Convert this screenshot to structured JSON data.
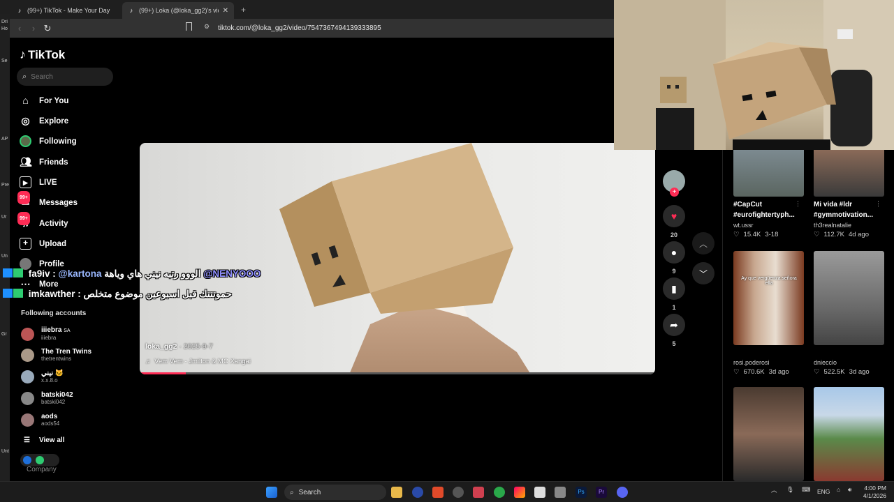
{
  "browser": {
    "tabs": [
      {
        "title": "(99+) TikTok - Make Your Day",
        "active": false
      },
      {
        "title": "(99+) Loka (@loka_gg2)'s videos",
        "active": true
      }
    ],
    "url": "tiktok.com/@loka_gg2/video/7547367494139333895"
  },
  "leftstrip": [
    "Dri",
    "Ho",
    "Se",
    "AP",
    "Pre",
    "Ur",
    "Un",
    "Gr",
    "Unt"
  ],
  "tiktok": {
    "logo": "TikTok",
    "search_placeholder": "Search",
    "nav": [
      {
        "label": "For You",
        "icon": "home-icon"
      },
      {
        "label": "Explore",
        "icon": "compass-icon"
      },
      {
        "label": "Following",
        "icon": "following-avatar-icon"
      },
      {
        "label": "Friends",
        "icon": "friends-icon"
      },
      {
        "label": "LIVE",
        "icon": "live-icon"
      },
      {
        "label": "Messages",
        "icon": "message-icon",
        "badge": "99+"
      },
      {
        "label": "Activity",
        "icon": "bell-icon",
        "badge": "99+"
      },
      {
        "label": "Upload",
        "icon": "upload-icon"
      },
      {
        "label": "Profile",
        "icon": "profile-icon"
      },
      {
        "label": "More",
        "icon": "more-icon"
      }
    ],
    "following_title": "Following accounts",
    "following": [
      {
        "name": "iiiebra",
        "extra": "SA",
        "handle": "iiiebra"
      },
      {
        "name": "The Tren Twins",
        "handle": "thetrentwins"
      },
      {
        "name": "نيني 🐱",
        "handle": "x.x.8.o"
      },
      {
        "name": "batski042",
        "handle": "batski042"
      },
      {
        "name": "aods",
        "handle": "aods54"
      }
    ],
    "view_all": "View all",
    "company": "Company"
  },
  "video": {
    "author": "loka_gg2",
    "date": "2025-9-7",
    "music": "Vem Vem - Jmilton & MC Xangai",
    "progress": 0.09,
    "likes": "20",
    "comments": "9",
    "saves": "1",
    "shares": "5"
  },
  "chat": [
    {
      "user": "fa9iv",
      "mention": "@kartona",
      "text": "الووو رتبه نيني هاي وياهة",
      "mention2": "@NENYOOO"
    },
    {
      "user": "imkawther",
      "text": "حموتتتك قبل اسبوعين موضوع متخلص"
    }
  ],
  "grid": [
    {
      "caption1": "#CapCut",
      "caption2": "#eurofightertyph...",
      "user": "wt.ussr",
      "likes": "15.4K",
      "date": "3-18"
    },
    {
      "caption1": "Mi vida #ldr",
      "caption2": "#gymmotivation...",
      "user": "th3realnatalie",
      "likes": "112.7K",
      "date": "4d ago"
    },
    {
      "user": "rosi.poderosi",
      "likes": "670.6K",
      "date": "3d ago",
      "thumb_text": "Ay que vergüenza señora ella"
    },
    {
      "user": "dnieccio",
      "likes": "522.5K",
      "date": "3d ago"
    }
  ],
  "taskbar": {
    "search_placeholder": "Search",
    "lang": "ENG",
    "time": "4:00 PM",
    "date": "4/1/2026"
  },
  "colors": {
    "accent": "#fe2c55",
    "background": "#000000"
  }
}
